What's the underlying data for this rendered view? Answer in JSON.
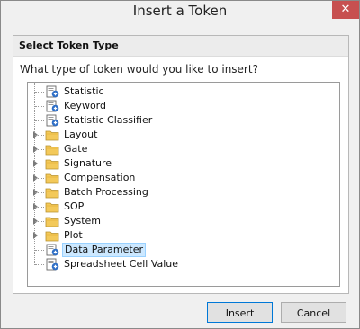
{
  "window": {
    "title": "Insert a Token",
    "close_glyph": "✕"
  },
  "group": {
    "title": "Select Token Type"
  },
  "question": "What type of token would you like to insert?",
  "tree": {
    "items": [
      {
        "label": "Statistic",
        "icon": "token-icon",
        "expandable": false
      },
      {
        "label": "Keyword",
        "icon": "token-icon",
        "expandable": false
      },
      {
        "label": "Statistic Classifier",
        "icon": "token-icon",
        "expandable": false
      },
      {
        "label": "Layout",
        "icon": "folder-icon",
        "expandable": true
      },
      {
        "label": "Gate",
        "icon": "folder-icon",
        "expandable": true
      },
      {
        "label": "Signature",
        "icon": "folder-icon",
        "expandable": true
      },
      {
        "label": "Compensation",
        "icon": "folder-icon",
        "expandable": true
      },
      {
        "label": "Batch Processing",
        "icon": "folder-icon",
        "expandable": true
      },
      {
        "label": "SOP",
        "icon": "folder-icon",
        "expandable": true
      },
      {
        "label": "System",
        "icon": "folder-icon",
        "expandable": true
      },
      {
        "label": "Plot",
        "icon": "folder-icon",
        "expandable": true
      },
      {
        "label": "Data Parameter",
        "icon": "token-icon",
        "expandable": false,
        "selected": true
      },
      {
        "label": "Spreadsheet Cell Value",
        "icon": "token-icon",
        "expandable": false
      }
    ]
  },
  "buttons": {
    "insert": "Insert",
    "cancel": "Cancel"
  },
  "colors": {
    "close_bg": "#c75050",
    "selection_bg": "#cce8ff",
    "folder": "#f3c95a",
    "token_badge": "#2f6fc6"
  }
}
